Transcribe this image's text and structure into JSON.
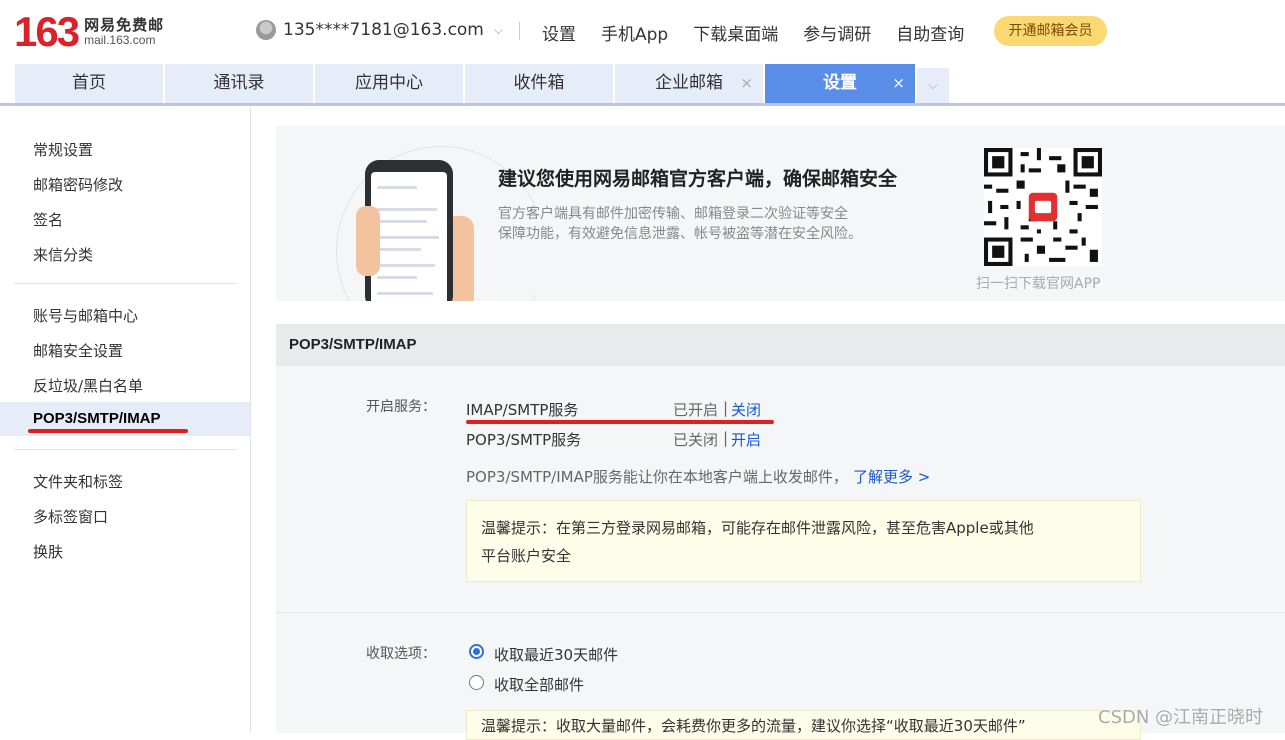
{
  "logo": {
    "number": "163",
    "cn": "网易免费邮",
    "en": "mail.163.com"
  },
  "account": {
    "email": "135****7181@163.com"
  },
  "topnav": [
    "设置",
    "手机App",
    "下载桌面端",
    "参与调研",
    "自助查询"
  ],
  "vip_button": "开通邮箱会员",
  "tabs": [
    {
      "label": "首页"
    },
    {
      "label": "通讯录"
    },
    {
      "label": "应用中心"
    },
    {
      "label": "收件箱"
    },
    {
      "label": "企业邮箱",
      "close": "×"
    },
    {
      "label": "设置",
      "close": "×",
      "active": true
    }
  ],
  "sidebar": {
    "group1": [
      "常规设置",
      "邮箱密码修改",
      "签名",
      "来信分类"
    ],
    "group2": [
      "账号与邮箱中心",
      "邮箱安全设置",
      "反垃圾/黑白名单",
      "POP3/SMTP/IMAP"
    ],
    "group3": [
      "文件夹和标签",
      "多标签窗口",
      "换肤"
    ],
    "active": "POP3/SMTP/IMAP"
  },
  "banner": {
    "title": "建议您使用网易邮箱官方客户端，确保邮箱安全",
    "desc_line1": "官方客户端具有邮件加密传输、邮箱登录二次验证等安全",
    "desc_line2": "保障功能，有效避免信息泄露、帐号被盗等潜在安全风险。",
    "qr_caption": "扫一扫下载官网APP"
  },
  "section": {
    "title": "POP3/SMTP/IMAP",
    "service_label": "开启服务：",
    "services": [
      {
        "name": "IMAP/SMTP服务",
        "status": "已开启",
        "sep": "|",
        "action": "关闭"
      },
      {
        "name": "POP3/SMTP服务",
        "status": "已关闭",
        "sep": "|",
        "action": "开启"
      }
    ],
    "info_text": "POP3/SMTP/IMAP服务能让你在本地客户端上收发邮件，",
    "learn_more": "了解更多 >",
    "tip_line1": "温馨提示：在第三方登录网易邮箱，可能存在邮件泄露风险，甚至危害Apple或其他",
    "tip_line2": "平台账户安全",
    "receive_label": "收取选项：",
    "receive_options": [
      {
        "label": "收取最近30天邮件",
        "checked": true
      },
      {
        "label": "收取全部邮件",
        "checked": false
      }
    ],
    "tip2_text": "温馨提示：收取大量邮件，会耗费你更多的流量，建议你选择“收取最近30天邮件”"
  },
  "watermark": "CSDN @江南正晓时",
  "colors": {
    "accent": "#5a8de8",
    "brand_red": "#d8232a",
    "vip": "#fbd872",
    "link": "#1a57c8"
  }
}
